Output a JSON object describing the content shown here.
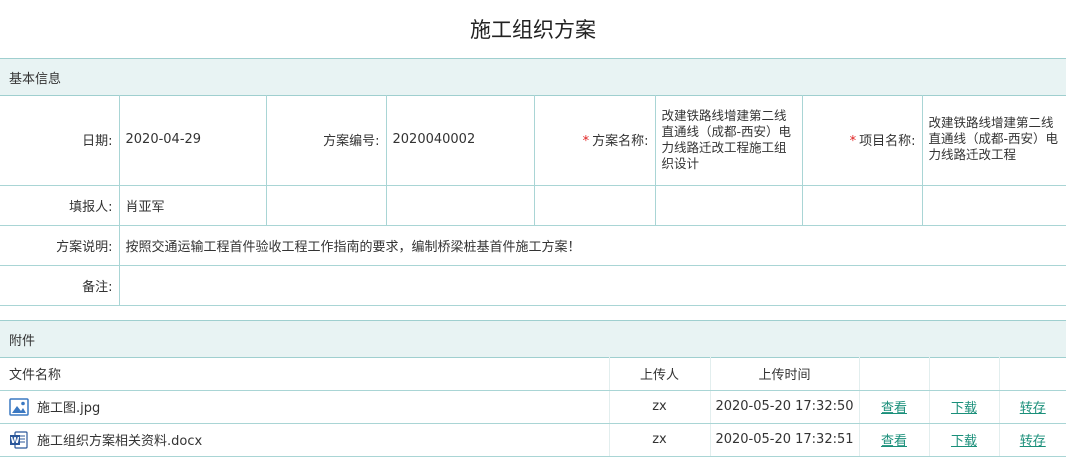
{
  "page": {
    "title": "施工组织方案"
  },
  "basic": {
    "header": "基本信息",
    "date_label": "日期:",
    "date_value": "2020-04-29",
    "plan_no_label": "方案编号:",
    "plan_no_value": "2020040002",
    "plan_name_label": "方案名称:",
    "plan_name_value": "改建铁路线增建第二线直通线（成都-西安）电力线路迁改工程施工组织设计",
    "project_label": "项目名称:",
    "project_value": "改建铁路线增建第二线直通线（成都-西安）电力线路迁改工程",
    "required_mark": "*",
    "filler_label": "填报人:",
    "filler_value": "肖亚军",
    "desc_label": "方案说明:",
    "desc_value": "按照交通运输工程首件验收工程工作指南的要求，编制桥梁桩基首件施工方案！",
    "remark_label": "备注:",
    "remark_value": ""
  },
  "attachments": {
    "header": "附件",
    "columns": {
      "name": "文件名称",
      "uploader": "上传人",
      "time": "上传时间"
    },
    "actions": {
      "view": "查看",
      "download": "下载",
      "transfer": "转存"
    },
    "files": [
      {
        "name": "施工图.jpg",
        "icon": "image-file-icon",
        "uploader": "zx",
        "time": "2020-05-20 17:32:50"
      },
      {
        "name": "施工组织方案相关资料.docx",
        "icon": "word-file-icon",
        "uploader": "zx",
        "time": "2020-05-20 17:32:51"
      }
    ]
  },
  "colors": {
    "accent": "#1a8f7a",
    "header_bg": "#e8f3f3",
    "border": "#a9d5d5",
    "required": "#e02020"
  }
}
